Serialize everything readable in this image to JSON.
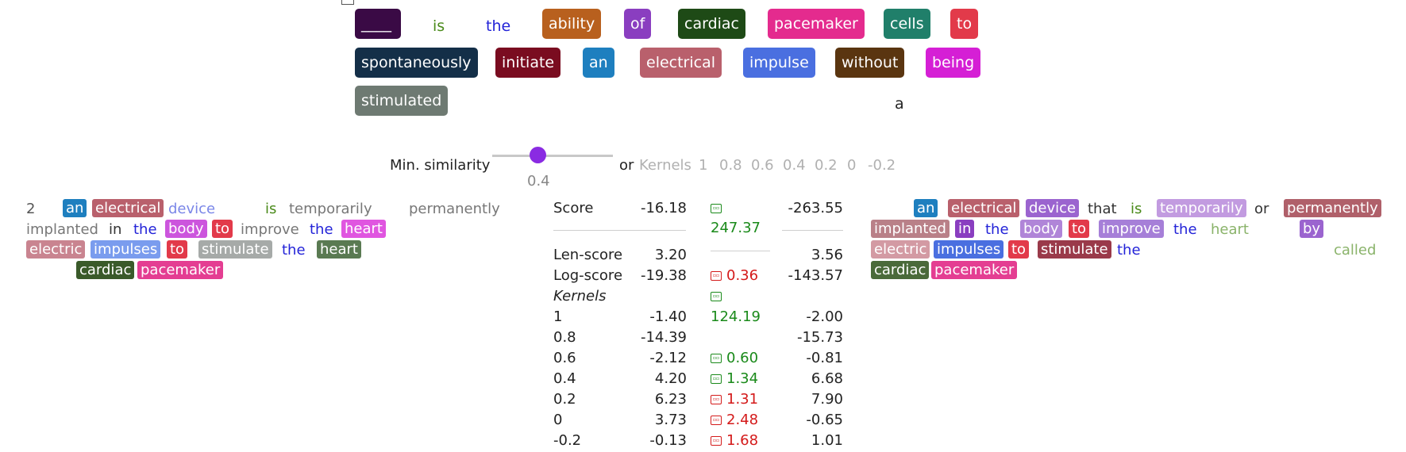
{
  "question": {
    "blank": "____",
    "words": [
      "is",
      "the",
      "ability",
      "of",
      "cardiac",
      "pacemaker",
      "cells",
      "to",
      "spontaneously",
      "initiate",
      "an",
      "electrical",
      "impulse",
      "without",
      "being",
      "stimulated"
    ],
    "answer": "a"
  },
  "controls": {
    "min_similarity_label": "Min. similarity",
    "min_similarity_value": "0.4",
    "min_similarity_level": 0.4,
    "or_label": "or",
    "kernels_label": "Kernels",
    "kernel_values": [
      "1",
      "0.8",
      "0.6",
      "0.4",
      "0.2",
      "0",
      "-0.2"
    ]
  },
  "left_passage": {
    "index": "2",
    "tokens": [
      "an",
      "electrical",
      "device",
      "is",
      "temporarily",
      "permanently",
      "implanted",
      "in",
      "the",
      "body",
      "to",
      "improve",
      "the",
      "heart",
      "electric",
      "impulses",
      "to",
      "stimulate",
      "the",
      "heart",
      "cardiac",
      "pacemaker"
    ]
  },
  "scores": {
    "score_label": "Score",
    "score_left": "-16.18",
    "score_delta": "247.37",
    "score_right": "-263.55",
    "len_label": "Len-score",
    "len_left": "3.20",
    "len_right": "3.56",
    "log_label": "Log-score",
    "log_left": "-19.38",
    "log_delta": "0.36",
    "log_right": "-143.57",
    "kernels_label": "Kernels",
    "kernels": [
      {
        "k": "1",
        "left": "-1.40",
        "delta": "124.19",
        "right": "-2.00"
      },
      {
        "k": "0.8",
        "left": "-14.39",
        "delta": "",
        "right": "-15.73"
      },
      {
        "k": "0.6",
        "left": "-2.12",
        "delta": "0.60",
        "right": "-0.81"
      },
      {
        "k": "0.4",
        "left": "4.20",
        "delta": "1.34",
        "right": "6.68"
      },
      {
        "k": "0.2",
        "left": "6.23",
        "delta": "1.31",
        "right": "7.90"
      },
      {
        "k": "0",
        "left": "3.73",
        "delta": "2.48",
        "right": "-0.65"
      },
      {
        "k": "-0.2",
        "left": "-0.13",
        "delta": "1.68",
        "right": "1.01"
      }
    ]
  },
  "right_passage": {
    "tokens": [
      "an",
      "electrical",
      "device",
      "that",
      "is",
      "temporarily",
      "or",
      "permanently",
      "implanted",
      "in",
      "the",
      "body",
      "to",
      "improve",
      "the",
      "heart",
      "by",
      "electric",
      "impulses",
      "to",
      "stimulate",
      "the",
      "called",
      "cardiac",
      "pacemaker"
    ]
  },
  "colors": {
    "blank": "#3a0a45",
    "is": "#4a8a1a",
    "the": "#2323d8",
    "ability": "#b8601e",
    "of": "#8a3ec0",
    "cardiac": "#1e4a16",
    "pacemaker": "#e42b8e",
    "cells": "#207f6a",
    "to": "#e23a4a",
    "spontaneously": "#142f48",
    "initiate": "#7a0c20",
    "an": "#1e7fbf",
    "electrical": "#b9606c",
    "impulse": "#4a6fe0",
    "without": "#5a3510",
    "being": "#d51fd5",
    "stimulated": "#6e7a72"
  }
}
